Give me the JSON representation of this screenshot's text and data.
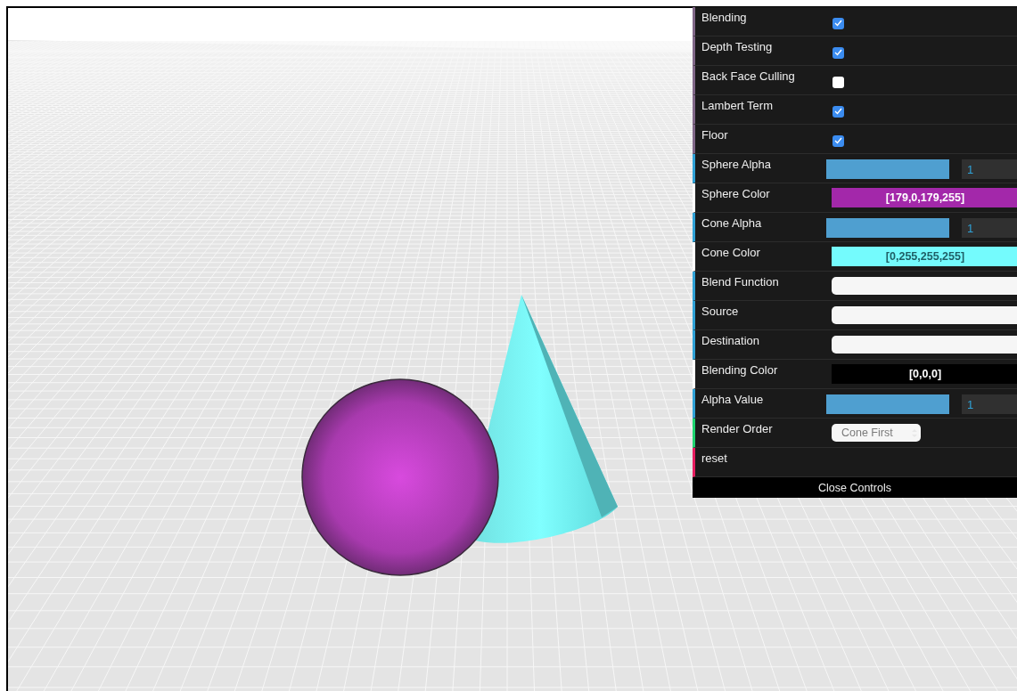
{
  "controls": [
    {
      "kind": "checkbox",
      "label": "Blending",
      "checked": true
    },
    {
      "kind": "checkbox",
      "label": "Depth Testing",
      "checked": true
    },
    {
      "kind": "checkbox",
      "label": "Back Face Culling",
      "checked": false
    },
    {
      "kind": "checkbox",
      "label": "Lambert Term",
      "checked": true
    },
    {
      "kind": "checkbox",
      "label": "Floor",
      "checked": true
    },
    {
      "kind": "slider",
      "label": "Sphere Alpha",
      "level": 1,
      "value": "1"
    },
    {
      "kind": "color",
      "label": "Sphere Color",
      "value": "[179,0,179,255]",
      "color": "#a328aa"
    },
    {
      "kind": "slider",
      "label": "Cone Alpha",
      "level": 1,
      "value": "1"
    },
    {
      "kind": "color",
      "label": "Cone Color",
      "value": "[0,255,255,255]",
      "color": "#74fbfd"
    },
    {
      "kind": "select",
      "label": "Blend Function"
    },
    {
      "kind": "select",
      "label": "Source"
    },
    {
      "kind": "select",
      "label": "Destination"
    },
    {
      "kind": "color",
      "label": "Blending Color",
      "value": "[0,0,0]",
      "color": "#000000"
    },
    {
      "kind": "slider",
      "label": "Alpha Value",
      "level": 1,
      "value": "1"
    },
    {
      "kind": "option",
      "label": "Render Order",
      "value": "Cone First"
    },
    {
      "kind": "function",
      "label": "reset"
    }
  ],
  "close_button": "Close Controls"
}
